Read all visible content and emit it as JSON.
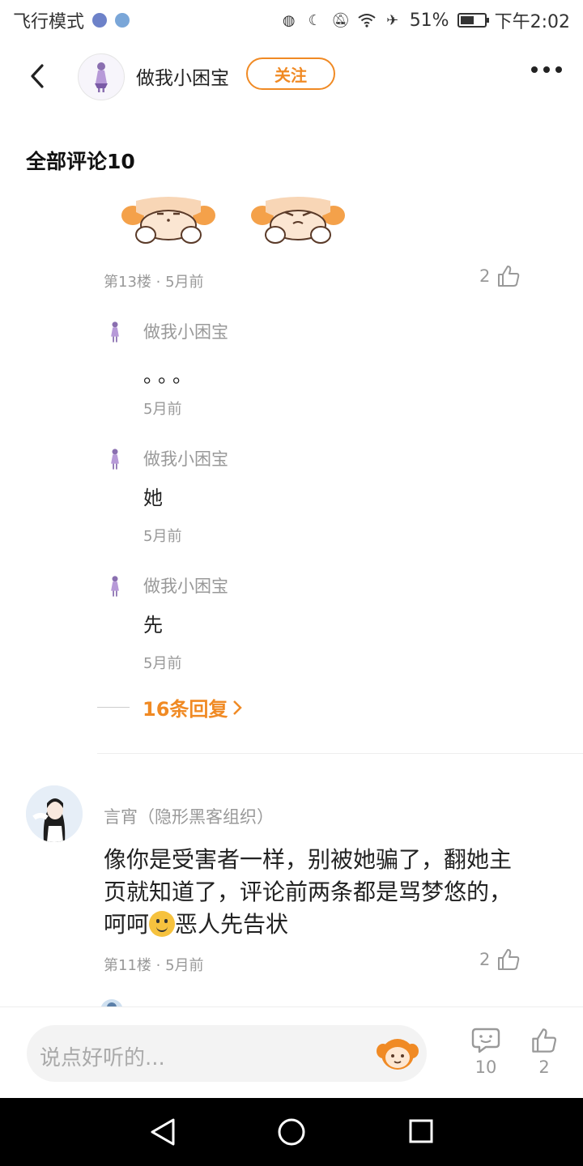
{
  "status_bar": {
    "left_text": "飞行模式",
    "battery": "51%",
    "time": "下午2:02"
  },
  "header": {
    "username": "做我小困宝",
    "follow_label": "关注"
  },
  "comments_section": {
    "title": "全部评论10"
  },
  "floor13": {
    "meta": "第13楼 · 5月前",
    "likes": "2",
    "replies": [
      {
        "name": "做我小困宝",
        "text": "。。。",
        "time": "5月前"
      },
      {
        "name": "做我小困宝",
        "text": "她",
        "time": "5月前"
      },
      {
        "name": "做我小困宝",
        "text": "先",
        "time": "5月前"
      }
    ],
    "more_replies": "16条回复"
  },
  "floor11": {
    "name": "言宵（隐形黑客组织）",
    "text_before_emoji": "像你是受害者一样，别被她骗了，翻她主页就知道了，评论前两条都是骂梦悠的，呵呵",
    "text_after_emoji": "恶人先告状",
    "meta": "第11楼 · 5月前",
    "likes": "2"
  },
  "bottom_bar": {
    "input_placeholder": "说点好听的...",
    "comment_count": "10",
    "like_count": "2"
  },
  "colors": {
    "accent": "#f08a24",
    "muted": "#999999"
  }
}
